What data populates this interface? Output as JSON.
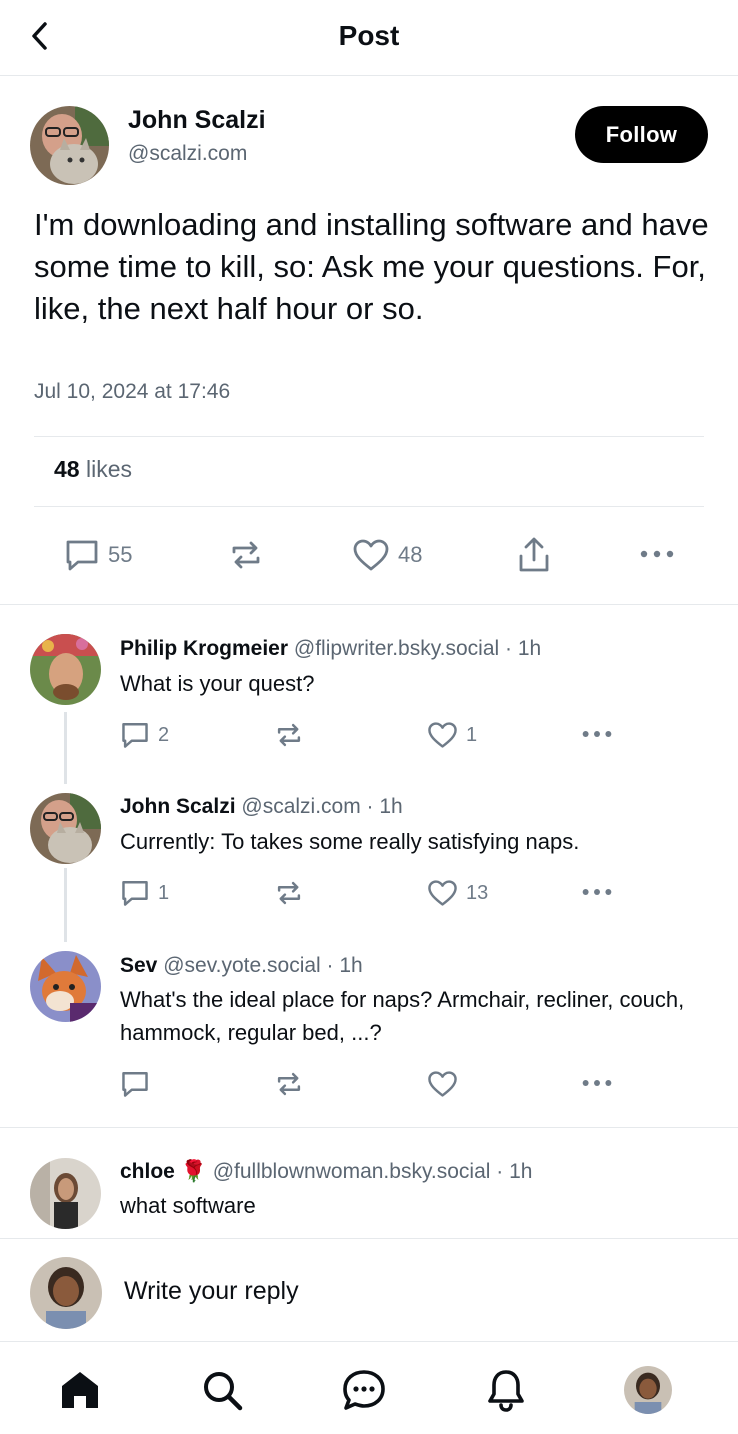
{
  "header": {
    "title": "Post"
  },
  "post": {
    "author_name": "John Scalzi",
    "author_handle": "@scalzi.com",
    "follow_label": "Follow",
    "text": "I'm downloading and installing software and have some time to kill, so: Ask me your questions. For, like, the next half hour or so.",
    "timestamp": "Jul 10, 2024 at 17:46",
    "likes_count": "48",
    "likes_label": "likes",
    "reply_count": "55",
    "like_count": "48"
  },
  "replies": [
    {
      "name": "Philip Krogmeier",
      "handle": "@flipwriter.bsky.social · 1h",
      "text": "What is your quest?",
      "reply_count": "2",
      "like_count": "1"
    },
    {
      "name": "John Scalzi",
      "handle": "@scalzi.com · 1h",
      "text": "Currently: To takes some really satisfying naps.",
      "reply_count": "1",
      "like_count": "13"
    },
    {
      "name": "Sev",
      "handle": "@sev.yote.social · 1h",
      "text": "What's the ideal place for naps? Armchair, recliner, couch, hammock, regular bed, ...?"
    },
    {
      "name": "chloe",
      "emoji": "🌹",
      "handle": "@fullblownwoman.bsky.social · 1h",
      "text": "what software"
    }
  ],
  "composer": {
    "placeholder": "Write your reply"
  },
  "icons": {
    "back": "chevron-left-icon",
    "reply": "speech-bubble-icon",
    "repost": "repost-arrows-icon",
    "like": "heart-icon",
    "share": "share-upload-icon",
    "more": "ellipsis-icon",
    "home": "home-icon",
    "search": "search-icon",
    "messages": "chat-bubble-icon",
    "notifications": "bell-icon"
  },
  "colors": {
    "accent": "#000000",
    "muted": "#5b6672",
    "icon": "#6f7b88",
    "divider": "#e6e9ec"
  }
}
